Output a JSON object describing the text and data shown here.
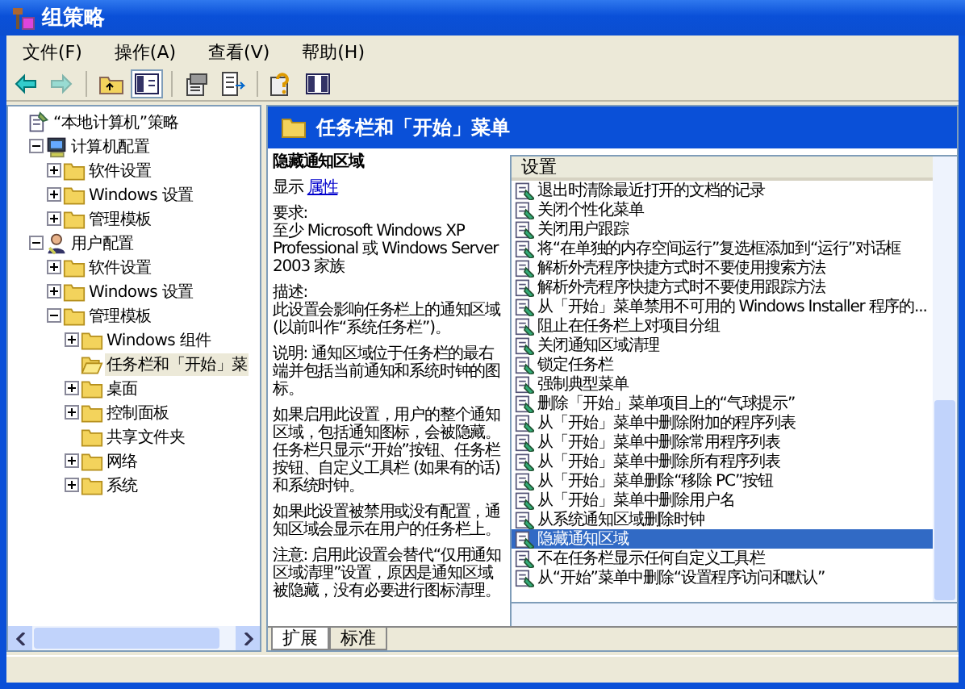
{
  "window": {
    "title": "组策略"
  },
  "menu": [
    "文件(F)",
    "操作(A)",
    "查看(V)",
    "帮助(H)"
  ],
  "toolbar": [
    {
      "kind": "back",
      "disabled": false,
      "pressed": false
    },
    {
      "kind": "forward",
      "disabled": true,
      "pressed": false
    },
    {
      "kind": "up",
      "disabled": false,
      "pressed": false
    },
    {
      "kind": "tree",
      "disabled": false,
      "pressed": true
    },
    {
      "kind": "properties",
      "disabled": false,
      "pressed": false
    },
    {
      "kind": "export",
      "disabled": false,
      "pressed": false
    },
    {
      "kind": "help",
      "disabled": false,
      "pressed": false
    },
    {
      "kind": "panes",
      "disabled": false,
      "pressed": false
    }
  ],
  "tree": [
    {
      "label": "“本地计算机”策略",
      "kind": "policy",
      "expandable": false,
      "selected": false,
      "children": [
        {
          "label": "计算机配置",
          "kind": "computer",
          "expandable": true,
          "expanded": true,
          "selected": false,
          "children": [
            {
              "label": "软件设置",
              "kind": "folder",
              "expandable": true,
              "expanded": false,
              "selected": false
            },
            {
              "label": "Windows 设置",
              "kind": "folder",
              "expandable": true,
              "expanded": false,
              "selected": false
            },
            {
              "label": "管理模板",
              "kind": "folder",
              "expandable": true,
              "expanded": false,
              "selected": false
            }
          ]
        },
        {
          "label": "用户配置",
          "kind": "user",
          "expandable": true,
          "expanded": true,
          "selected": false,
          "children": [
            {
              "label": "软件设置",
              "kind": "folder",
              "expandable": true,
              "expanded": false,
              "selected": false
            },
            {
              "label": "Windows 设置",
              "kind": "folder",
              "expandable": true,
              "expanded": false,
              "selected": false
            },
            {
              "label": "管理模板",
              "kind": "folder",
              "expandable": true,
              "expanded": true,
              "selected": false,
              "children": [
                {
                  "label": "Windows 组件",
                  "kind": "folder",
                  "expandable": true,
                  "expanded": false,
                  "selected": false
                },
                {
                  "label": "任务栏和「开始」菜",
                  "kind": "folder",
                  "expandable": false,
                  "selected": true
                },
                {
                  "label": "桌面",
                  "kind": "folder",
                  "expandable": true,
                  "expanded": false,
                  "selected": false
                },
                {
                  "label": "控制面板",
                  "kind": "folder",
                  "expandable": true,
                  "expanded": false,
                  "selected": false
                },
                {
                  "label": "共享文件夹",
                  "kind": "folder",
                  "expandable": false,
                  "selected": false
                },
                {
                  "label": "网络",
                  "kind": "folder",
                  "expandable": true,
                  "expanded": false,
                  "selected": false
                },
                {
                  "label": "系统",
                  "kind": "folder",
                  "expandable": true,
                  "expanded": false,
                  "selected": false
                }
              ]
            }
          ]
        }
      ]
    }
  ],
  "header": {
    "title": "任务栏和「开始」菜单"
  },
  "description": {
    "title": "隐藏通知区域",
    "show_label": "显示",
    "show_link": "属性",
    "paragraphs": [
      "要求:\n至少 Microsoft Windows XP Professional 或 Windows Server 2003 家族",
      "描述:\n此设置会影响任务栏上的通知区域 (以前叫作“系统任务栏”)。",
      "说明: 通知区域位于任务栏的最右端并包括当前通知和系统时钟的图标。",
      "如果启用此设置，用户的整个通知区域，包括通知图标，会被隐藏。任务栏只显示“开始”按钮、任务栏按钮、自定义工具栏 (如果有的话)和系统时钟。",
      "如果此设置被禁用或没有配置，通知区域会显示在用户的任务栏上。",
      "注意: 启用此设置会替代“仅用通知区域清理”设置，原因是通知区域被隐藏，没有必要进行图标清理。"
    ]
  },
  "settings": {
    "column": "设置",
    "rows": [
      {
        "label": "退出时清除最近打开的文档的记录",
        "selected": false
      },
      {
        "label": "关闭个性化菜单",
        "selected": false
      },
      {
        "label": "关闭用户跟踪",
        "selected": false
      },
      {
        "label": "将“在单独的内存空间运行”复选框添加到“运行”对话框",
        "selected": false
      },
      {
        "label": "解析外壳程序快捷方式时不要使用搜索方法",
        "selected": false
      },
      {
        "label": "解析外壳程序快捷方式时不要使用跟踪方法",
        "selected": false
      },
      {
        "label": "从「开始」菜单禁用不可用的 Windows Installer 程序的...",
        "selected": false
      },
      {
        "label": "阻止在任务栏上对项目分组",
        "selected": false
      },
      {
        "label": "关闭通知区域清理",
        "selected": false
      },
      {
        "label": "锁定任务栏",
        "selected": false
      },
      {
        "label": "强制典型菜单",
        "selected": false
      },
      {
        "label": "删除「开始」菜单项目上的“气球提示”",
        "selected": false
      },
      {
        "label": "从「开始」菜单中删除附加的程序列表",
        "selected": false
      },
      {
        "label": "从「开始」菜单中删除常用程序列表",
        "selected": false
      },
      {
        "label": "从「开始」菜单中删除所有程序列表",
        "selected": false
      },
      {
        "label": "从「开始」菜单删除“移除 PC”按钮",
        "selected": false
      },
      {
        "label": "从「开始」菜单中删除用户名",
        "selected": false
      },
      {
        "label": "从系统通知区域删除时钟",
        "selected": false
      },
      {
        "label": "隐藏通知区域",
        "selected": true
      },
      {
        "label": "不在任务栏显示任何自定义工具栏",
        "selected": false
      },
      {
        "label": "从“开始”菜单中删除“设置程序访问和默认”",
        "selected": false
      }
    ]
  },
  "tabs": [
    {
      "label": "扩展",
      "selected": true
    },
    {
      "label": "标准",
      "selected": false
    }
  ]
}
